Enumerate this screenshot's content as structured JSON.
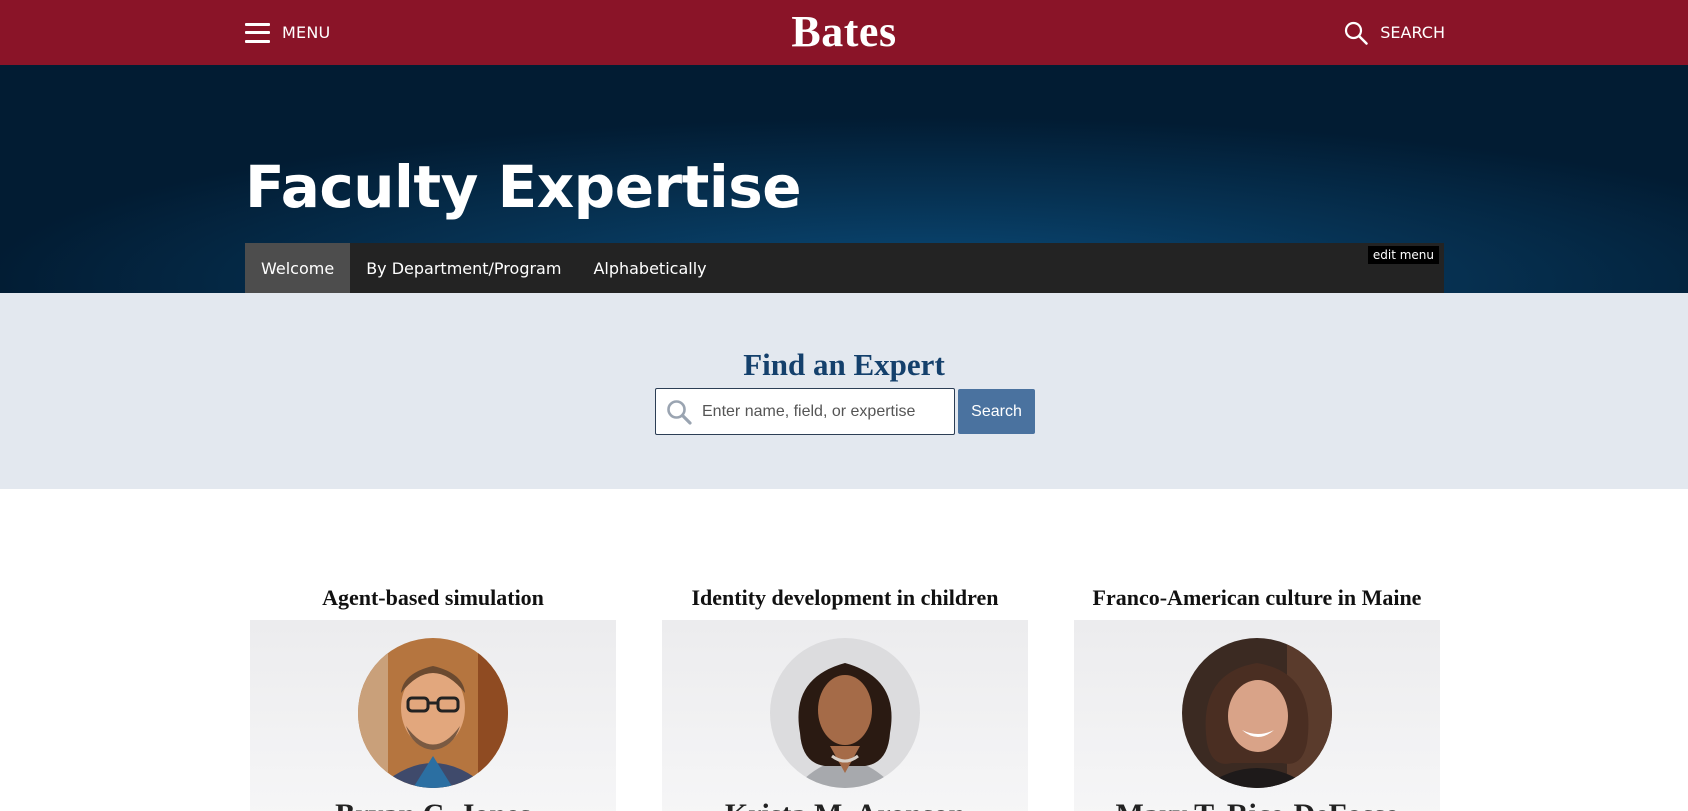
{
  "header": {
    "menu_label": "MENU",
    "logo": "Bates",
    "search_label": "SEARCH",
    "brand_color": "#8a1428"
  },
  "hero": {
    "title": "Faculty Expertise",
    "subnav": [
      {
        "label": "Welcome",
        "active": true
      },
      {
        "label": "By Department/Program",
        "active": false
      },
      {
        "label": "Alphabetically",
        "active": false
      }
    ],
    "edit_menu": "edit menu"
  },
  "finder": {
    "title": "Find an Expert",
    "placeholder": "Enter name, field, or expertise",
    "button": "Search"
  },
  "experts": [
    {
      "topic": "Agent-based simulation",
      "name": "Bryan C. Jones",
      "icon": "faculty-photo-man-glasses"
    },
    {
      "topic": "Identity development in children",
      "name": "Krista M. Aronson",
      "icon": "faculty-photo-woman-curly-hair"
    },
    {
      "topic": "Franco-American culture in Maine",
      "name": "Mary T. Rice-DeFosse",
      "icon": "faculty-photo-woman-smiling"
    }
  ]
}
